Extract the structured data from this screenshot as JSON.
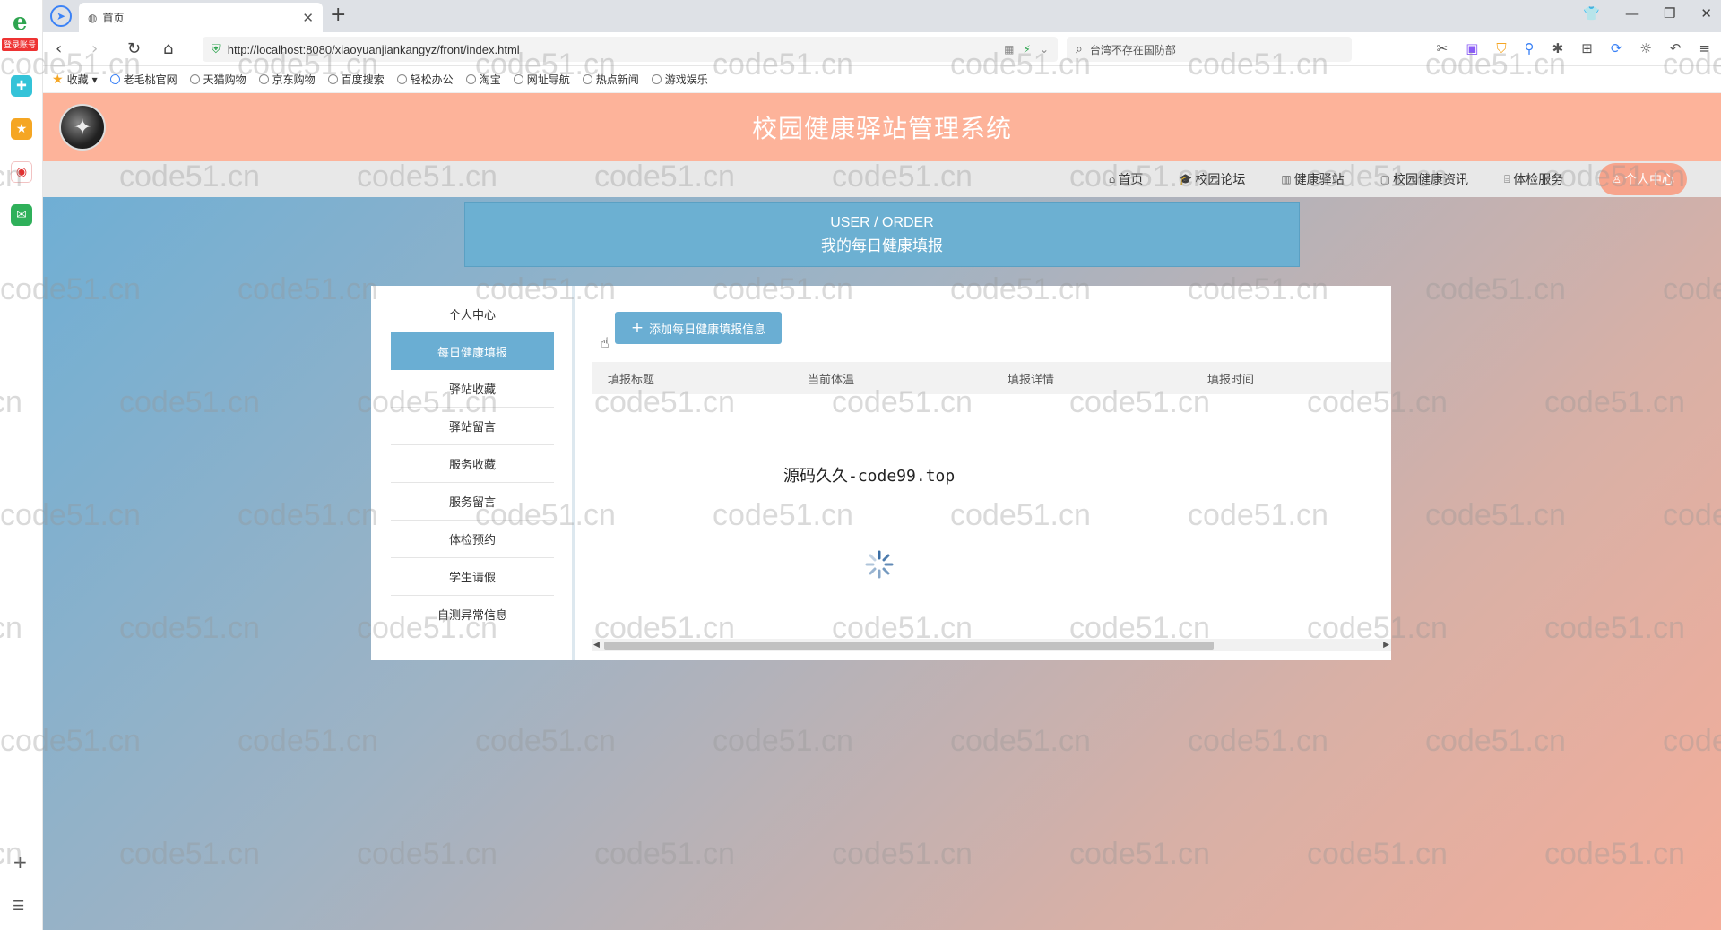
{
  "browser": {
    "login_badge": "登录账号",
    "tab": {
      "title": "首页"
    },
    "address": {
      "url": "http://localhost:8080/xiaoyuanjiankangyz/front/index.html",
      "search_placeholder": "台湾不存在国防部"
    },
    "bookmarks": [
      {
        "label": "收藏"
      },
      {
        "label": "老毛桃官网"
      },
      {
        "label": "天猫购物"
      },
      {
        "label": "京东购物"
      },
      {
        "label": "百度搜索"
      },
      {
        "label": "轻松办公"
      },
      {
        "label": "淘宝"
      },
      {
        "label": "网址导航"
      },
      {
        "label": "热点新闻"
      },
      {
        "label": "游戏娱乐"
      }
    ]
  },
  "site": {
    "title": "校园健康驿站管理系统",
    "nav": [
      {
        "icon": "home-icon",
        "label": "首页"
      },
      {
        "icon": "forum-icon",
        "label": "校园论坛"
      },
      {
        "icon": "station-icon",
        "label": "健康驿站"
      },
      {
        "icon": "news-icon",
        "label": "校园健康资讯"
      },
      {
        "icon": "checkup-icon",
        "label": "体检服务"
      },
      {
        "icon": "user-icon",
        "label": "个人中心"
      }
    ]
  },
  "breadcrumb": {
    "en": "USER / ORDER",
    "cn": "我的每日健康填报"
  },
  "menu": [
    {
      "label": "个人中心"
    },
    {
      "label": "每日健康填报"
    },
    {
      "label": "驿站收藏"
    },
    {
      "label": "驿站留言"
    },
    {
      "label": "服务收藏"
    },
    {
      "label": "服务留言"
    },
    {
      "label": "体检预约"
    },
    {
      "label": "学生请假"
    },
    {
      "label": "自测异常信息"
    }
  ],
  "content": {
    "add_button": "添加每日健康填报信息",
    "columns": [
      "填报标题",
      "当前体温",
      "填报详情",
      "填报时间"
    ],
    "overlay_text": "源码久久-code99.top"
  },
  "watermark": "code51.cn",
  "colors": {
    "header": "#fdb39a",
    "accent_blue": "#6aaed3",
    "nav_active": "#f7a48c"
  }
}
